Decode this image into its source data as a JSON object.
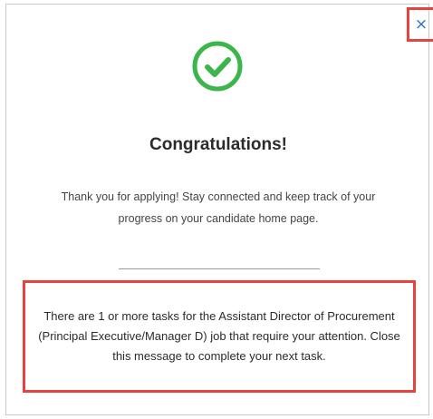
{
  "dialog": {
    "close_label": "×",
    "success_icon": "check-circle-icon",
    "success_color": "#3cb54a",
    "title": "Congratulations!",
    "subtitle": "Thank you for applying! Stay connected and keep track of your progress on your candidate home page.",
    "task_message": "There are 1 or more tasks for the Assistant Director of Procurement (Principal Executive/Manager D) job that require your attention. Close this message to complete your next task."
  },
  "colors": {
    "highlight": "#e8423f",
    "close_icon": "#2a6fd1"
  }
}
